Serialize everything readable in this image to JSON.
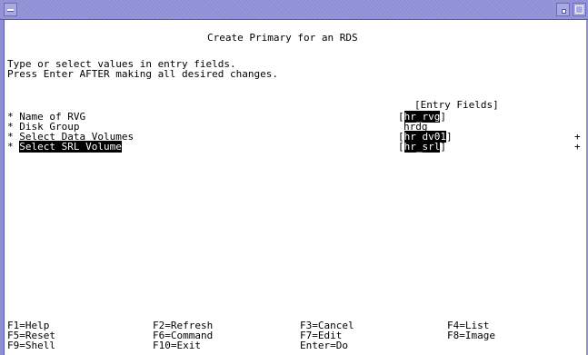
{
  "window": {
    "title": ""
  },
  "screen": {
    "title": "Create Primary for an RDS",
    "instructions": [
      "Type or select values in entry fields.",
      "Press Enter AFTER making all desired changes."
    ],
    "entry_header": "[Entry Fields]",
    "fields": [
      {
        "marker": "*",
        "label": "Name of RVG",
        "open": "[",
        "value": "hr_rvg",
        "close": "]",
        "highlighted": true,
        "list": ""
      },
      {
        "marker": "*",
        "label": "Disk Group",
        "open": "",
        "value": "hrdg",
        "close": "",
        "highlighted": false,
        "list": ""
      },
      {
        "marker": "*",
        "label": "Select Data Volumes",
        "open": "[",
        "value": "hr_dv01",
        "close": "]",
        "highlighted": true,
        "list": "+"
      },
      {
        "marker": "*",
        "label": "Select SRL Volume",
        "open": "[",
        "value": "hr_srl",
        "close": "]",
        "highlighted": true,
        "list": "+"
      }
    ]
  },
  "function_keys": [
    [
      "F1=Help",
      "F2=Refresh",
      "F3=Cancel",
      "F4=List"
    ],
    [
      "F5=Reset",
      "F6=Command",
      "F7=Edit",
      "F8=Image"
    ],
    [
      "F9=Shell",
      "F10=Exit",
      "Enter=Do",
      ""
    ]
  ],
  "colors": {
    "titlebar": "#8f8fd6",
    "background": "#ffffff",
    "text": "#000000",
    "highlight_bg": "#000000",
    "highlight_fg": "#ffffff"
  }
}
